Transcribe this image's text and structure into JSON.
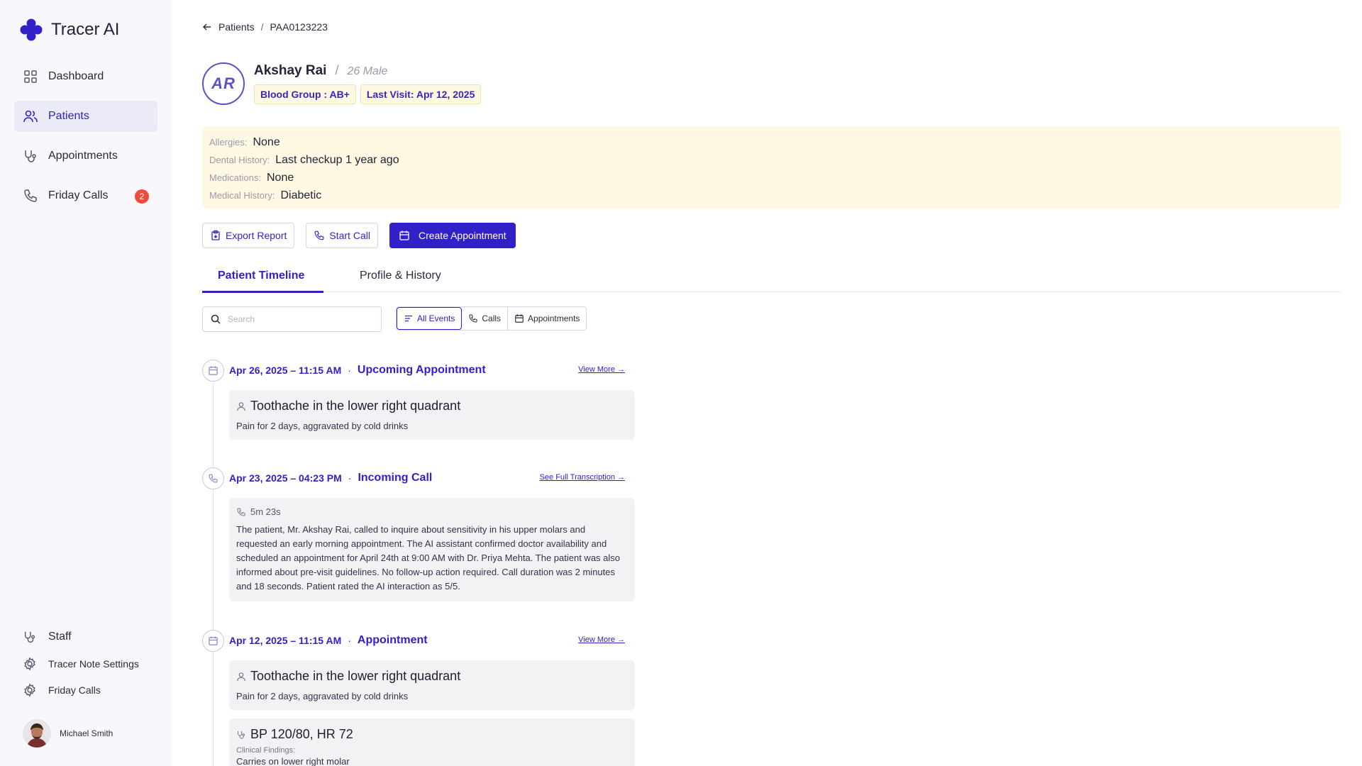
{
  "app": {
    "name": "Tracer AI"
  },
  "sidebar": {
    "items": [
      {
        "label": "Dashboard",
        "icon": "grid-icon"
      },
      {
        "label": "Patients",
        "icon": "users-icon",
        "active": true
      },
      {
        "label": "Appointments",
        "icon": "stethoscope-icon"
      },
      {
        "label": "Friday Calls",
        "icon": "phone-icon",
        "badge": "2"
      }
    ],
    "bottom": [
      {
        "label": "Staff",
        "icon": "stethoscope-icon"
      },
      {
        "label": "Tracer Note Settings",
        "icon": "gear-icon"
      },
      {
        "label": "Friday Calls",
        "icon": "gear-icon"
      }
    ],
    "user": {
      "name": "Michael Smith"
    }
  },
  "breadcrumb": {
    "parent": "Patients",
    "separator": "/",
    "current": "PAA0123223"
  },
  "patient": {
    "initials": "AR",
    "name": "Akshay Rai",
    "separator": "/",
    "meta": "26 Male",
    "chips": [
      "Blood Group : AB+",
      "Last Visit: Apr 12, 2025"
    ],
    "info": [
      {
        "label": "Allergies:",
        "value": "None"
      },
      {
        "label": "Dental History:",
        "value": "Last checkup 1 year ago"
      },
      {
        "label": "Medications:",
        "value": "None"
      },
      {
        "label": "Medical History:",
        "value": "Diabetic"
      }
    ]
  },
  "actions": {
    "export": "Export Report",
    "call": "Start Call",
    "create": "Create Appointment"
  },
  "tabs": [
    "Patient Timeline",
    "Profile & History"
  ],
  "search": {
    "placeholder": "Search"
  },
  "filters": [
    "All Events",
    "Calls",
    "Appointments"
  ],
  "timeline": [
    {
      "date": "Apr 26, 2025 – 11:15 AM",
      "dot": "·",
      "type": "Upcoming Appointment",
      "link": "View More →",
      "card_title": "Toothache in the lower right quadrant",
      "card_sub": "Pain for 2 days, aggravated by cold drinks"
    },
    {
      "date": "Apr 23, 2025 –  04:23 PM",
      "dot": "·",
      "type": "Incoming Call",
      "link": "See Full Transcription →",
      "duration": "5m 23s",
      "transcript": "The patient, Mr. Akshay Rai, called to inquire about sensitivity in his upper molars and requested an early morning appointment. The AI assistant confirmed doctor availability and scheduled an appointment for April 24th at 9:00 AM with Dr. Priya Mehta. The patient was also informed about pre-visit guidelines. No follow-up action required. Call duration was 2 minutes and 18 seconds. Patient rated the AI interaction as 5/5."
    },
    {
      "date": "Apr 12, 2025 – 11:15 AM",
      "dot": "·",
      "type": "Appointment",
      "link": "View More →",
      "card_title": "Toothache in the lower right quadrant",
      "card_sub": "Pain for 2 days, aggravated by cold drinks",
      "vitals": "BP 120/80, HR 72",
      "findings_label": "Clinical Findings:",
      "findings": "Carries on lower right molar"
    }
  ],
  "colors": {
    "accent": "#3220c8",
    "panel": "#fff9e3",
    "badge": "#ee4b3a",
    "sidebar_bg": "#f8f8fc"
  }
}
